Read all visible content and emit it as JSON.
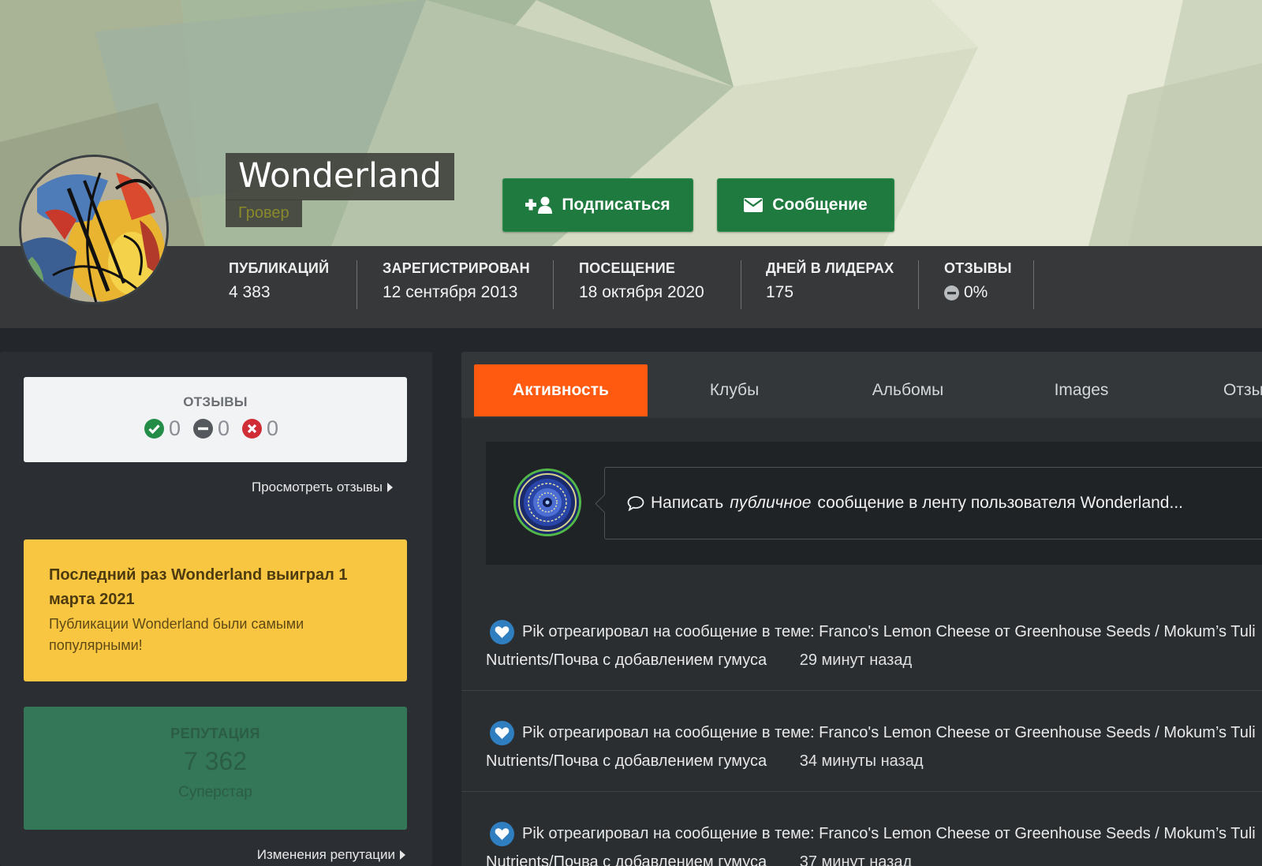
{
  "profile": {
    "name": "Wonderland",
    "rank": "Гровер",
    "follow_label": "Подписаться",
    "message_label": "Сообщение"
  },
  "stats": [
    {
      "label": "ПУБЛИКАЦИЙ",
      "value": "4 383"
    },
    {
      "label": "ЗАРЕГИСТРИРОВАН",
      "value": "12 сентября 2013"
    },
    {
      "label": "ПОСЕЩЕНИЕ",
      "value": "18 октября 2020"
    },
    {
      "label": "ДНЕЙ В ЛИДЕРАХ",
      "value": "175"
    },
    {
      "label": "ОТЗЫВЫ",
      "value": "0%"
    }
  ],
  "sidebar": {
    "feedback_title": "ОТЗЫВЫ",
    "feedback_positive": "0",
    "feedback_neutral": "0",
    "feedback_negative": "0",
    "view_feedback_link": "Просмотреть отзывы",
    "winner_title": "Последний раз Wonderland выиграл 1 марта 2021",
    "winner_text": "Публикации Wonderland были самыми популярными!",
    "reputation_title": "РЕПУТАЦИЯ",
    "reputation_value": "7 362",
    "reputation_rank": "Суперстар",
    "reputation_changes_link": "Изменения репутации"
  },
  "tabs": [
    {
      "label": "Активность"
    },
    {
      "label": "Клубы"
    },
    {
      "label": "Альбомы"
    },
    {
      "label": "Images"
    },
    {
      "label": "Отзы"
    }
  ],
  "composer": {
    "prefix": "Написать",
    "emphasis": "публичное",
    "suffix": "сообщение в ленту пользователя Wonderland..."
  },
  "activity": [
    {
      "text": "Pik отреагировал на сообщение в теме: Franco's Lemon Cheese от Greenhouse Seeds / Mokum’s Tuli",
      "topic_cont": "Nutrients/Почва с добавлением гумуса",
      "time": "29 минут назад"
    },
    {
      "text": "Pik отреагировал на сообщение в теме: Franco's Lemon Cheese от Greenhouse Seeds / Mokum’s Tuli",
      "topic_cont": "Nutrients/Почва с добавлением гумуса",
      "time": "34 минуты назад"
    },
    {
      "text": "Pik отреагировал на сообщение в теме: Franco's Lemon Cheese от Greenhouse Seeds / Mokum’s Tuli",
      "topic_cont": "Nutrients/Почва с добавлением гумуса",
      "time": "37 минут назад"
    }
  ],
  "colors": {
    "accent_tab": "#ff5a0f",
    "button_green": "#1f7a3f",
    "winner_yellow": "#f9c641",
    "reputation_green": "#347658",
    "background": "#23272b"
  },
  "icons": [
    "user-plus-icon",
    "envelope-icon",
    "minus-circle-icon",
    "check-circle-icon",
    "x-circle-icon",
    "caret-right-icon",
    "speech-bubble-icon",
    "heart-icon"
  ]
}
